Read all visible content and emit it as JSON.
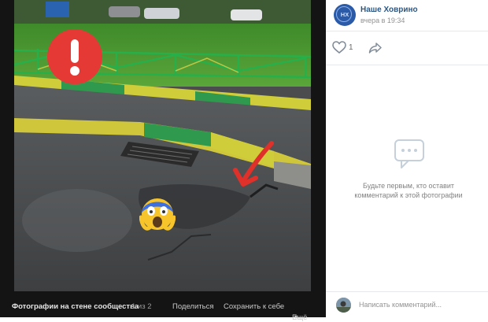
{
  "viewer": {
    "album_title": "Фотографии на стене сообщества",
    "counter": "1 из 2",
    "share_label": "Поделиться",
    "save_label": "Сохранить к себе",
    "more_label": "Ещё"
  },
  "post": {
    "group_name": "Наше Ховрино",
    "group_initials": "НХ",
    "date": "вчера в 19:34",
    "likes": "1"
  },
  "comments": {
    "empty_text": "Будьте первым, кто оставит комментарий к этой фотографии",
    "input_placeholder": "Написать комментарий..."
  },
  "colors": {
    "group_name": "#2a5885",
    "viewer_bg": "#141414",
    "warning_red": "#e53935"
  },
  "icons": [
    "exclamation-icon",
    "scared-emoji-icon",
    "red-arrow-icon",
    "heart-icon",
    "share-arrow-icon",
    "comment-bubble-icon",
    "chevron-down-icon"
  ]
}
